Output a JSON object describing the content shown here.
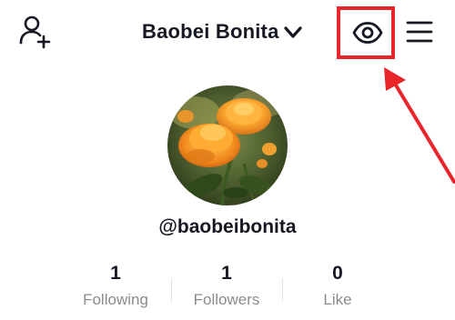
{
  "header": {
    "add_user_icon": "add-user-icon",
    "account_name": "Baobei Bonita",
    "dropdown_icon": "chevron-down-icon",
    "eye_icon": "eye-icon",
    "menu_icon": "hamburger-menu-icon"
  },
  "profile": {
    "avatar_description": "orange-flowers-photo",
    "handle": "@baobeibonita"
  },
  "stats": [
    {
      "value": "1",
      "label": "Following"
    },
    {
      "value": "1",
      "label": "Followers"
    },
    {
      "value": "0",
      "label": "Like"
    }
  ],
  "annotation": {
    "color": "#e8252b",
    "target": "eye-icon"
  }
}
